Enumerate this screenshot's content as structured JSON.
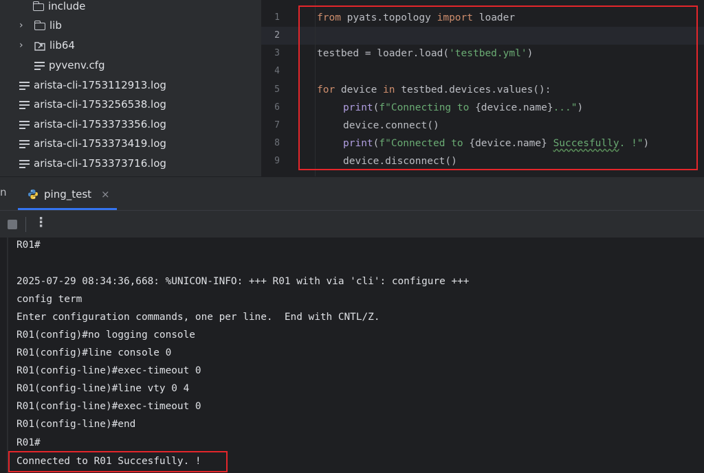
{
  "project_tree": {
    "items": [
      {
        "label": "include",
        "type": "folder"
      },
      {
        "label": "lib",
        "type": "folder"
      },
      {
        "label": "lib64",
        "type": "link-folder"
      },
      {
        "label": "pyvenv.cfg",
        "type": "file"
      },
      {
        "label": "arista-cli-1753112913.log",
        "type": "file"
      },
      {
        "label": "arista-cli-1753256538.log",
        "type": "file"
      },
      {
        "label": "arista-cli-1753373356.log",
        "type": "file"
      },
      {
        "label": "arista-cli-1753373419.log",
        "type": "file"
      },
      {
        "label": "arista-cli-1753373716.log",
        "type": "file"
      }
    ]
  },
  "editor": {
    "line_numbers": [
      "1",
      "2",
      "3",
      "4",
      "5",
      "6",
      "7",
      "8",
      "9"
    ],
    "active_line": "2",
    "tokens": {
      "l1_from": "from",
      "l1_mid": " pyats.topology ",
      "l1_import": "import",
      "l1_end": " loader",
      "l3_a": "testbed = loader.load(",
      "l3_str": "'testbed.yml'",
      "l3_b": ")",
      "l5_for": "for",
      "l5_mid": " device ",
      "l5_in": "in",
      "l5_end": " testbed.devices.values():",
      "l6_print": "print",
      "l6_a": "(",
      "l6_s1": "f\"Connecting to ",
      "l6_v": "{device.name}",
      "l6_s2": "...\"",
      "l6_b": ")",
      "l7": "device.connect()",
      "l8_print": "print",
      "l8_a": "(",
      "l8_s1": "f\"Connected to ",
      "l8_v": "{device.name}",
      "l8_sp": " ",
      "l8_w": "Succesfully",
      "l8_s2": ". !\"",
      "l8_b": ")",
      "l9": "device.disconnect()"
    }
  },
  "run_panel": {
    "prev_tab_fragment": "n",
    "tab_label": "ping_test",
    "tab_close": "×",
    "toolbar_more": "⋮"
  },
  "console": {
    "lines": [
      "R01#",
      "",
      "2025-07-29 08:34:36,668: %UNICON-INFO: +++ R01 with via 'cli': configure +++",
      "config term",
      "Enter configuration commands, one per line.  End with CNTL/Z.",
      "R01(config)#no logging console",
      "R01(config)#line console 0",
      "R01(config-line)#exec-timeout 0",
      "R01(config-line)#line vty 0 4",
      "R01(config-line)#exec-timeout 0",
      "R01(config-line)#end",
      "R01#",
      "Connected to R01 Succesfully. !"
    ]
  },
  "colors": {
    "highlight_box": "#e5262b",
    "keyword": "#cf8e6d",
    "function": "#b09ee0",
    "string": "#6aab73",
    "tab_underline": "#3574f0"
  }
}
